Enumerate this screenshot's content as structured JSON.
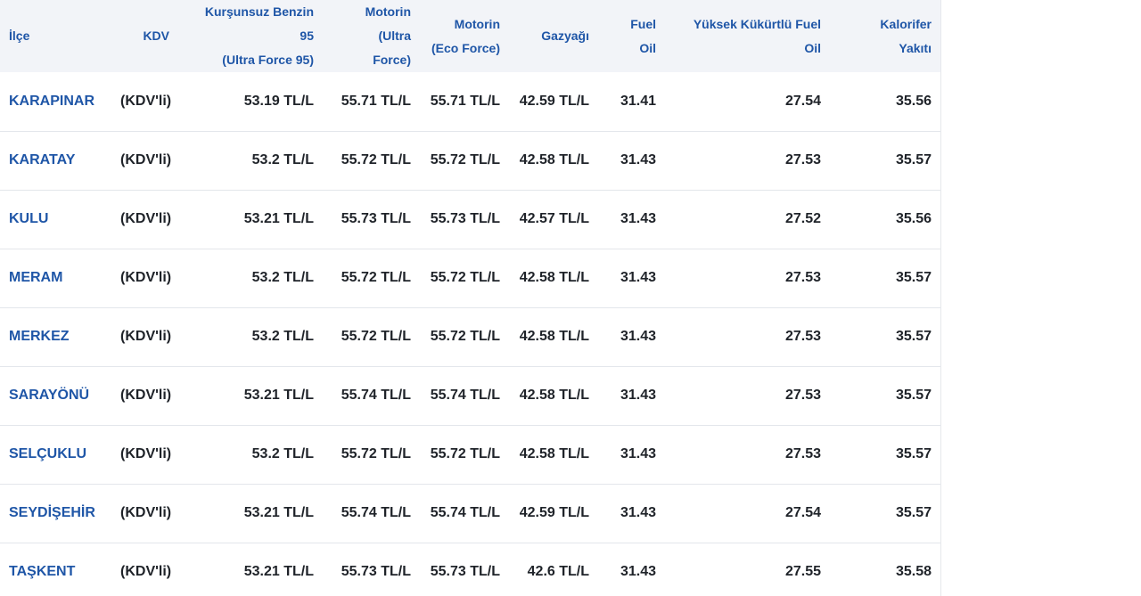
{
  "headers": {
    "ilce": "İlçe",
    "kdv": "KDV",
    "benzin": [
      "Kurşunsuz Benzin",
      "95",
      "(Ultra Force 95)"
    ],
    "motorin_ultra": [
      "Motorin",
      "(Ultra",
      "Force)"
    ],
    "motorin_eco": [
      "Motorin",
      "(Eco Force)"
    ],
    "gazyagi": "Gazyağı",
    "fuel_oil": [
      "Fuel",
      "Oil"
    ],
    "yuksek_kukurtlu": [
      "Yüksek Kükürtlü Fuel",
      "Oil"
    ],
    "kalorifer": [
      "Kalorifer",
      "Yakıtı"
    ]
  },
  "rows": [
    {
      "ilce": "KARAPINAR",
      "kdv": "(KDV'li)",
      "benzin": "53.19 TL/L",
      "motorin_ultra": "55.71 TL/L",
      "motorin_eco": "55.71 TL/L",
      "gazyagi": "42.59 TL/L",
      "fuel_oil": "31.41",
      "yuksek_kukurtlu": "27.54",
      "kalorifer": "35.56"
    },
    {
      "ilce": "KARATAY",
      "kdv": "(KDV'li)",
      "benzin": "53.2 TL/L",
      "motorin_ultra": "55.72 TL/L",
      "motorin_eco": "55.72 TL/L",
      "gazyagi": "42.58 TL/L",
      "fuel_oil": "31.43",
      "yuksek_kukurtlu": "27.53",
      "kalorifer": "35.57"
    },
    {
      "ilce": "KULU",
      "kdv": "(KDV'li)",
      "benzin": "53.21 TL/L",
      "motorin_ultra": "55.73 TL/L",
      "motorin_eco": "55.73 TL/L",
      "gazyagi": "42.57 TL/L",
      "fuel_oil": "31.43",
      "yuksek_kukurtlu": "27.52",
      "kalorifer": "35.56"
    },
    {
      "ilce": "MERAM",
      "kdv": "(KDV'li)",
      "benzin": "53.2 TL/L",
      "motorin_ultra": "55.72 TL/L",
      "motorin_eco": "55.72 TL/L",
      "gazyagi": "42.58 TL/L",
      "fuel_oil": "31.43",
      "yuksek_kukurtlu": "27.53",
      "kalorifer": "35.57"
    },
    {
      "ilce": "MERKEZ",
      "kdv": "(KDV'li)",
      "benzin": "53.2 TL/L",
      "motorin_ultra": "55.72 TL/L",
      "motorin_eco": "55.72 TL/L",
      "gazyagi": "42.58 TL/L",
      "fuel_oil": "31.43",
      "yuksek_kukurtlu": "27.53",
      "kalorifer": "35.57"
    },
    {
      "ilce": "SARAYÖNÜ",
      "kdv": "(KDV'li)",
      "benzin": "53.21 TL/L",
      "motorin_ultra": "55.74 TL/L",
      "motorin_eco": "55.74 TL/L",
      "gazyagi": "42.58 TL/L",
      "fuel_oil": "31.43",
      "yuksek_kukurtlu": "27.53",
      "kalorifer": "35.57"
    },
    {
      "ilce": "SELÇUKLU",
      "kdv": "(KDV'li)",
      "benzin": "53.2 TL/L",
      "motorin_ultra": "55.72 TL/L",
      "motorin_eco": "55.72 TL/L",
      "gazyagi": "42.58 TL/L",
      "fuel_oil": "31.43",
      "yuksek_kukurtlu": "27.53",
      "kalorifer": "35.57"
    },
    {
      "ilce": "SEYDİŞEHİR",
      "kdv": "(KDV'li)",
      "benzin": "53.21 TL/L",
      "motorin_ultra": "55.74 TL/L",
      "motorin_eco": "55.74 TL/L",
      "gazyagi": "42.59 TL/L",
      "fuel_oil": "31.43",
      "yuksek_kukurtlu": "27.54",
      "kalorifer": "35.57"
    },
    {
      "ilce": "TAŞKENT",
      "kdv": "(KDV'li)",
      "benzin": "53.21 TL/L",
      "motorin_ultra": "55.73 TL/L",
      "motorin_eco": "55.73 TL/L",
      "gazyagi": "42.6 TL/L",
      "fuel_oil": "31.43",
      "yuksek_kukurtlu": "27.55",
      "kalorifer": "35.58"
    }
  ],
  "colors": {
    "header_bg": "#f2f4f8",
    "accent": "#1f56a7",
    "text": "#1f2329",
    "row_border": "#e3e6eb"
  }
}
